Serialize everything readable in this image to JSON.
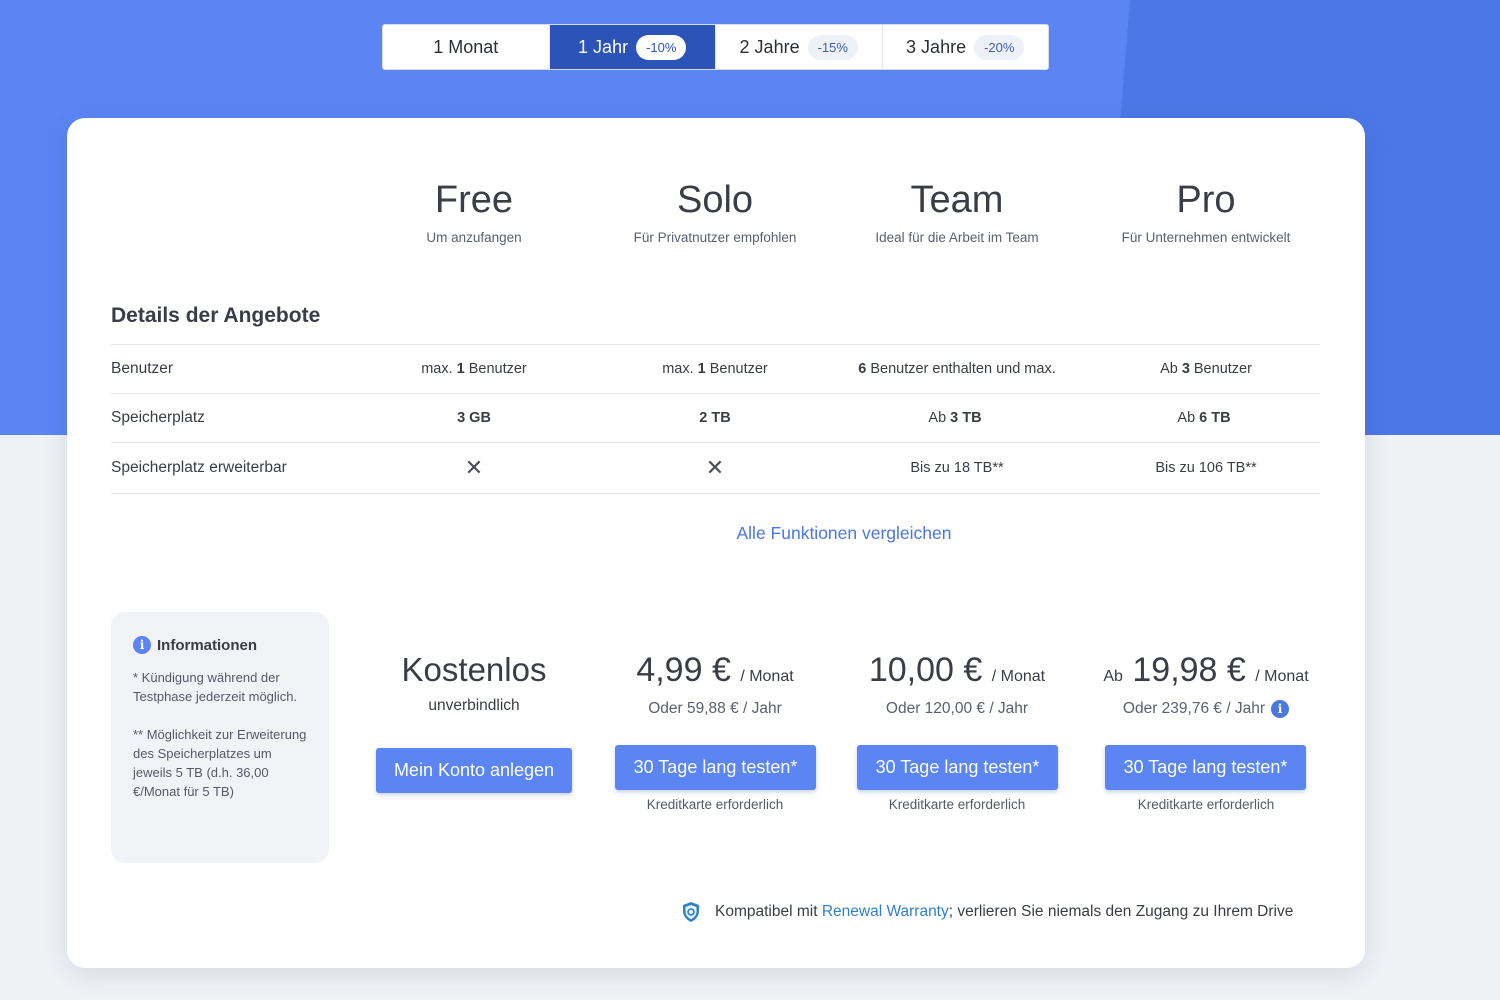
{
  "colors": {
    "accent": "#5a85f3",
    "active_tab": "#2b53b8",
    "link": "#4a78e0"
  },
  "period_tabs": [
    {
      "label": "1 Monat",
      "badge": ""
    },
    {
      "label": "1 Jahr",
      "badge": "-10%",
      "active": true
    },
    {
      "label": "2 Jahre",
      "badge": "-15%"
    },
    {
      "label": "3 Jahre",
      "badge": "-20%"
    }
  ],
  "plans": [
    {
      "name": "Free",
      "subtitle": "Um anzufangen"
    },
    {
      "name": "Solo",
      "subtitle": "Für Privatnutzer empfohlen"
    },
    {
      "name": "Team",
      "subtitle": "Ideal für die Arbeit im Team"
    },
    {
      "name": "Pro",
      "subtitle": "Für Unternehmen entwickelt"
    }
  ],
  "details": {
    "title": "Details der Angebote",
    "rows": [
      {
        "label": "Benutzer",
        "cells": [
          {
            "pre": "max.",
            "bold": "1",
            "post": "Benutzer"
          },
          {
            "pre": "max.",
            "bold": "1",
            "post": "Benutzer"
          },
          {
            "pre": "",
            "bold": "6",
            "post": "Benutzer enthalten und max."
          },
          {
            "pre": "Ab",
            "bold": "3",
            "post": "Benutzer"
          }
        ]
      },
      {
        "label": "Speicherplatz",
        "cells": [
          {
            "pre": "",
            "bold": "3 GB",
            "post": ""
          },
          {
            "pre": "",
            "bold": "2 TB",
            "post": ""
          },
          {
            "pre": "Ab",
            "bold": "3 TB",
            "post": ""
          },
          {
            "pre": "Ab",
            "bold": "6 TB",
            "post": ""
          }
        ]
      },
      {
        "label": "Speicherplatz erweiterbar",
        "cells": [
          {
            "cross": "✕"
          },
          {
            "cross": "✕"
          },
          {
            "pre": "Bis zu 18 TB**",
            "bold": "",
            "post": ""
          },
          {
            "pre": "Bis zu 106 TB**",
            "bold": "",
            "post": ""
          }
        ]
      }
    ],
    "compare_link": "Alle Funktionen vergleichen"
  },
  "info": {
    "icon": "info-icon",
    "title": "Informationen",
    "note1": "* Kündigung während der Testphase jederzeit möglich.",
    "note2": "** Möglichkeit zur Erweiterung des Speicherplatzes um jeweils 5 TB (d.h. 36,00 €/Monat für 5 TB)"
  },
  "pricing": {
    "free": {
      "title": "Kostenlos",
      "subtitle": "unverbindlich",
      "button": "Mein Konto anlegen"
    },
    "solo": {
      "prefix": "",
      "amount": "4,99 €",
      "per": "/ Monat",
      "yearly": "Oder 59,88 € / Jahr",
      "button": "30 Tage lang testen*",
      "note": "Kreditkarte erforderlich"
    },
    "team": {
      "prefix": "",
      "amount": "10,00 €",
      "per": "/ Monat",
      "yearly": "Oder 120,00 € / Jahr",
      "button": "30 Tage lang testen*",
      "note": "Kreditkarte erforderlich"
    },
    "pro": {
      "prefix": "Ab",
      "amount": "19,98 €",
      "per": "/ Monat",
      "yearly": "Oder 239,76 € / Jahr",
      "button": "30 Tage lang testen*",
      "note": "Kreditkarte erforderlich"
    }
  },
  "footer": {
    "icon": "shield-icon",
    "pre": "Kompatibel mit",
    "link": "Renewal Warranty",
    "post": "; verlieren Sie niemals den Zugang zu Ihrem Drive"
  }
}
